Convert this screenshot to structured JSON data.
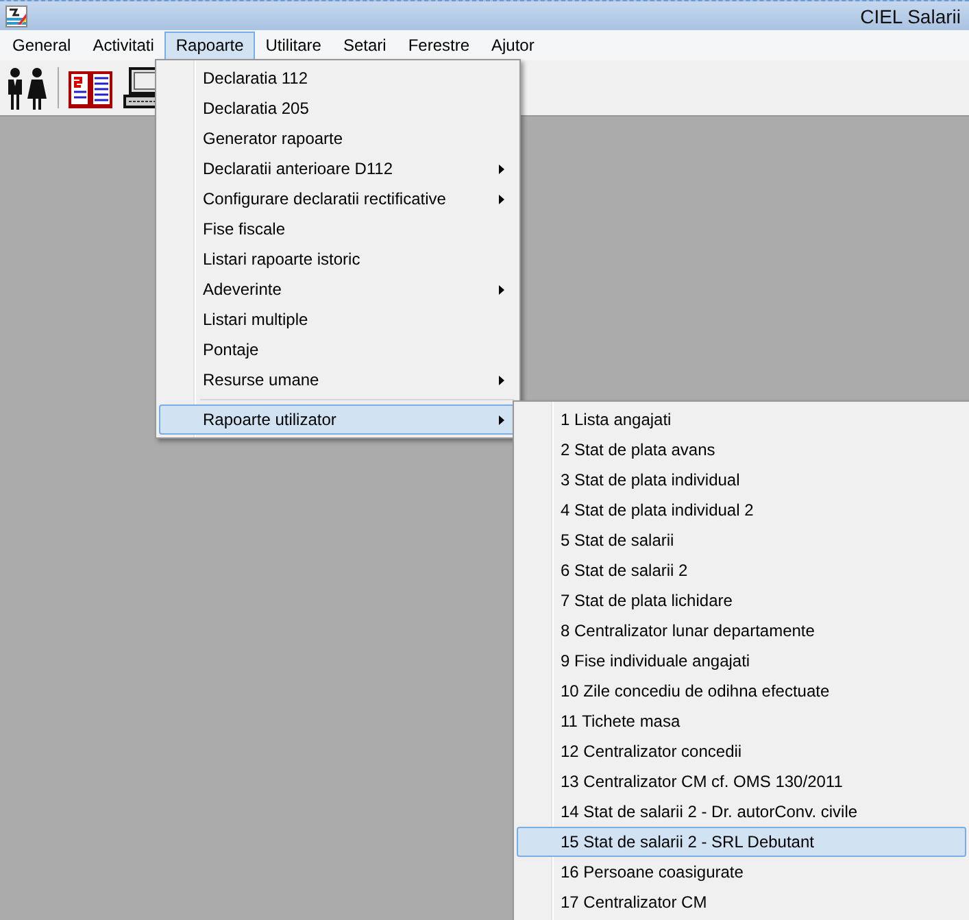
{
  "window": {
    "title": "CIEL Salarii"
  },
  "menu_bar": [
    {
      "label": "General",
      "selected": false
    },
    {
      "label": "Activitati",
      "selected": false
    },
    {
      "label": "Rapoarte",
      "selected": true
    },
    {
      "label": "Utilitare",
      "selected": false
    },
    {
      "label": "Setari",
      "selected": false
    },
    {
      "label": "Ferestre",
      "selected": false
    },
    {
      "label": "Ajutor",
      "selected": false
    }
  ],
  "rapoarte_menu": [
    {
      "kind": "item",
      "label": "Declaratia 112",
      "submenu": false,
      "selected": false
    },
    {
      "kind": "item",
      "label": "Declaratia 205",
      "submenu": false,
      "selected": false
    },
    {
      "kind": "item",
      "label": "Generator rapoarte",
      "submenu": false,
      "selected": false
    },
    {
      "kind": "item",
      "label": "Declaratii anterioare D112",
      "submenu": true,
      "selected": false
    },
    {
      "kind": "item",
      "label": "Configurare declaratii rectificative",
      "submenu": true,
      "selected": false
    },
    {
      "kind": "item",
      "label": "Fise fiscale",
      "submenu": false,
      "selected": false
    },
    {
      "kind": "item",
      "label": "Listari rapoarte istoric",
      "submenu": false,
      "selected": false
    },
    {
      "kind": "item",
      "label": "Adeverinte",
      "submenu": true,
      "selected": false
    },
    {
      "kind": "item",
      "label": "Listari multiple",
      "submenu": false,
      "selected": false
    },
    {
      "kind": "item",
      "label": "Pontaje",
      "submenu": false,
      "selected": false
    },
    {
      "kind": "item",
      "label": "Resurse umane",
      "submenu": true,
      "selected": false
    },
    {
      "kind": "separator"
    },
    {
      "kind": "item",
      "label": "Rapoarte utilizator",
      "submenu": true,
      "selected": true
    }
  ],
  "rapoarte_utilizator_submenu": [
    {
      "label": "1 Lista angajati",
      "selected": false
    },
    {
      "label": "2 Stat de plata avans",
      "selected": false
    },
    {
      "label": "3 Stat de plata individual",
      "selected": false
    },
    {
      "label": "4 Stat de plata individual 2",
      "selected": false
    },
    {
      "label": "5 Stat de salarii",
      "selected": false
    },
    {
      "label": "6 Stat de salarii 2",
      "selected": false
    },
    {
      "label": "7 Stat de plata lichidare",
      "selected": false
    },
    {
      "label": "8 Centralizator lunar departamente",
      "selected": false
    },
    {
      "label": "9 Fise individuale angajati",
      "selected": false
    },
    {
      "label": "10 Zile concediu de odihna efectuate",
      "selected": false
    },
    {
      "label": "11 Tichete masa",
      "selected": false
    },
    {
      "label": "12 Centralizator concedii",
      "selected": false
    },
    {
      "label": "13 Centralizator CM cf. OMS 130/2011",
      "selected": false
    },
    {
      "label": "14 Stat de salarii 2 - Dr. autorConv. civile",
      "selected": false
    },
    {
      "label": "15 Stat de salarii 2 - SRL Debutant",
      "selected": true
    },
    {
      "label": "16 Persoane coasigurate",
      "selected": false
    },
    {
      "label": "17 Centralizator CM",
      "selected": false
    }
  ]
}
